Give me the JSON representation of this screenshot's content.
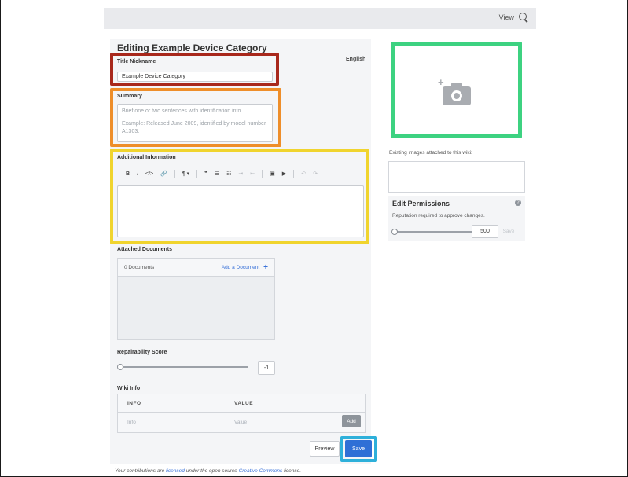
{
  "topbar": {
    "view_label": "View",
    "search_icon": "search-icon"
  },
  "editor": {
    "title": "Editing Example Device Category",
    "language": "English",
    "title_nickname": {
      "label": "Title Nickname",
      "value": "Example Device Category"
    },
    "summary": {
      "label": "Summary",
      "placeholder_line1": "Brief one or two sentences with identification info.",
      "placeholder_line2": "Example: Released June 2009, identified by model number A1303."
    },
    "additional_info": {
      "label": "Additional Information",
      "toolbar": {
        "bold": "B",
        "italic": "I",
        "code": "</>",
        "link": "🔗",
        "paragraph": "¶ ▾",
        "quote": "❞",
        "bullet_list": "☰",
        "numbered_list": "☷",
        "indent": "⇥",
        "outdent": "⇤",
        "image": "▣",
        "video": "▶",
        "undo": "↶",
        "redo": "↷"
      }
    },
    "attached_documents": {
      "label": "Attached Documents",
      "count": "0 Documents",
      "add_label": "Add a Document",
      "add_icon": "+"
    },
    "repairability": {
      "label": "Repairability Score",
      "value": "-1",
      "slider_fraction": 0
    },
    "wiki_info": {
      "label": "Wiki Info",
      "col_info": "INFO",
      "col_value": "VALUE",
      "info_placeholder": "Info",
      "value_placeholder": "Value",
      "add_label": "Add"
    },
    "buttons": {
      "preview": "Preview",
      "save": "Save"
    },
    "license": {
      "prefix": "Your contributions are ",
      "licensed": "licensed",
      "middle": " under the open source ",
      "cc": "Creative Commons",
      "suffix": " license."
    }
  },
  "sidebar": {
    "existing_images_label": "Existing images attached to this wiki:",
    "permissions": {
      "title": "Edit Permissions",
      "help": "?",
      "description": "Reputation required to approve changes.",
      "value": "500",
      "save_label": "Save",
      "slider_fraction": 0
    }
  },
  "highlights": {
    "red": "#a8281c",
    "orange": "#ee8e2a",
    "yellow": "#f0d42e",
    "green": "#3dd281",
    "blue": "#2eb0da"
  }
}
